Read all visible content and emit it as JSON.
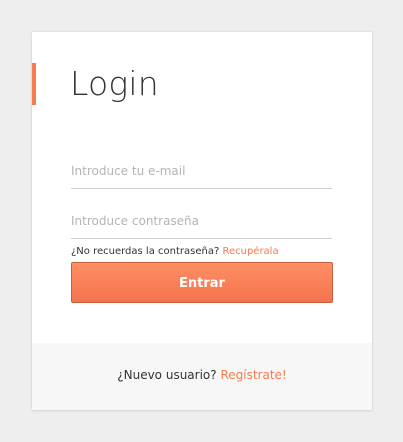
{
  "login": {
    "title": "Login",
    "email_placeholder": "Introduce tu e-mail",
    "password_placeholder": "Introduce contraseña",
    "forgot_text": "¿No recuerdas la contraseña?",
    "forgot_link": "Recupérala",
    "submit_label": "Entrar"
  },
  "footer": {
    "new_user_text": "¿Nuevo usuario?",
    "register_link": "Regístrate!"
  },
  "colors": {
    "accent": "#f47c50",
    "background": "#eeeeee",
    "card": "#ffffff",
    "footer_bg": "#f7f7f7"
  }
}
